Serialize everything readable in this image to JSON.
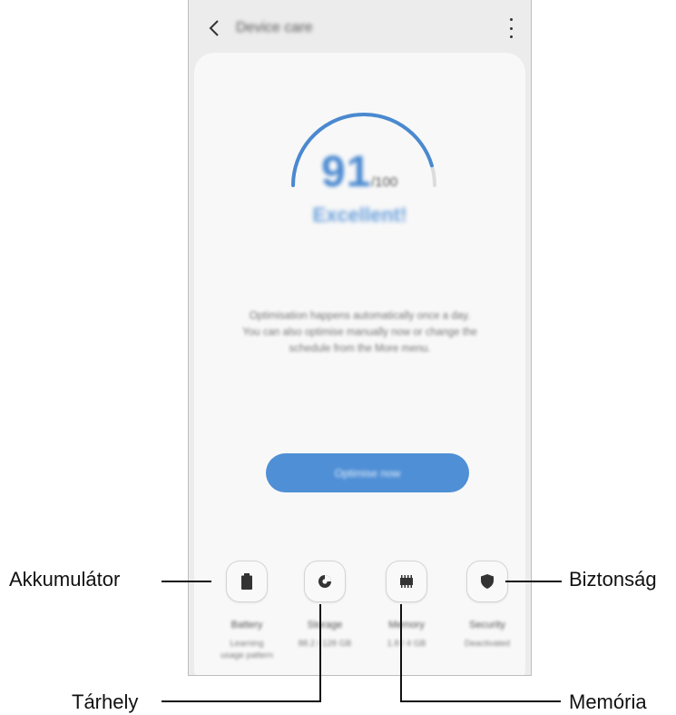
{
  "screen": {
    "title": "Device care",
    "score": "91",
    "score_max": "/100",
    "status": "Excellent!",
    "description": [
      "Optimisation happens automatically once a day.",
      "You can also optimise manually now or change the",
      "schedule from the More menu."
    ],
    "optimize_label": "Optimise now",
    "score_fraction": 0.91,
    "accent_color": "#4a89d0"
  },
  "tiles": [
    {
      "label": "Battery",
      "sub": [
        "Learning",
        "usage pattern"
      ],
      "icon": "battery-icon"
    },
    {
      "label": "Storage",
      "sub": [
        "88.2 / 128 GB"
      ],
      "icon": "storage-pie-icon"
    },
    {
      "label": "Memory",
      "sub": [
        "1.8 / 4 GB"
      ],
      "icon": "memory-chip-icon"
    },
    {
      "label": "Security",
      "sub": [
        "Deactivated"
      ],
      "icon": "shield-icon"
    }
  ],
  "callouts": {
    "battery": "Akkumulátor",
    "storage": "Tárhely",
    "memory": "Memória",
    "security": "Biztonság"
  }
}
